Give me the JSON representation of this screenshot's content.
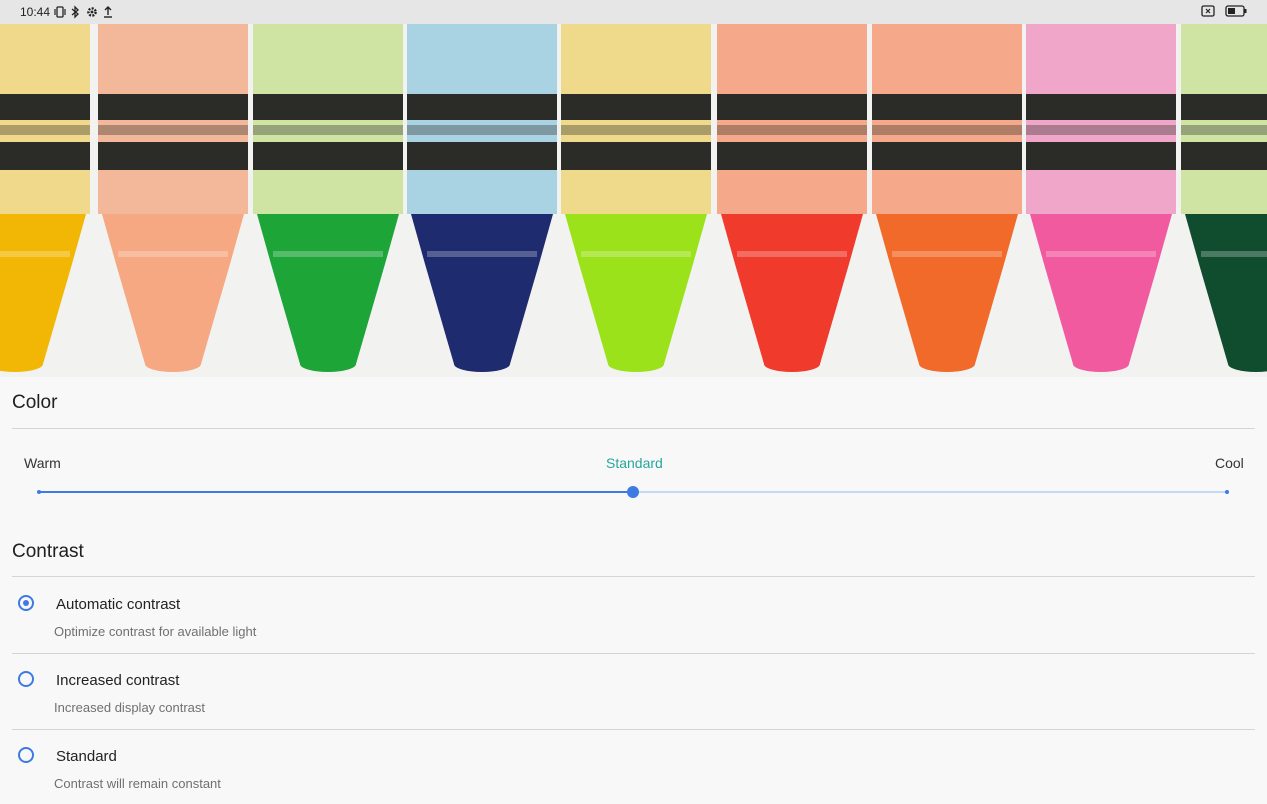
{
  "status_bar": {
    "time": "10:44",
    "icons": [
      "vibrate-icon",
      "bluetooth-icon",
      "settings-icon",
      "upload-icon"
    ],
    "right_icons": [
      "no-sim-icon",
      "battery-icon"
    ]
  },
  "hero": {
    "image": "crayons-photo",
    "colors": [
      "#f2b705",
      "#f6a883",
      "#1ea538",
      "#1e2b6e",
      "#9be21a",
      "#f03b2c",
      "#f26a2a",
      "#f25aa0",
      "#0f4d2e"
    ]
  },
  "color_section": {
    "title": "Color",
    "labels": {
      "warm": "Warm",
      "standard": "Standard",
      "cool": "Cool"
    },
    "selected": "Standard",
    "position": 0.5,
    "accent": "#3d7ae4",
    "active_label_color": "#26a69a"
  },
  "contrast_section": {
    "title": "Contrast",
    "options": [
      {
        "label": "Automatic contrast",
        "description": "Optimize contrast for available light",
        "selected": true
      },
      {
        "label": "Increased contrast",
        "description": "Increased display contrast",
        "selected": false
      },
      {
        "label": "Standard",
        "description": "Contrast will remain constant",
        "selected": false
      }
    ]
  }
}
